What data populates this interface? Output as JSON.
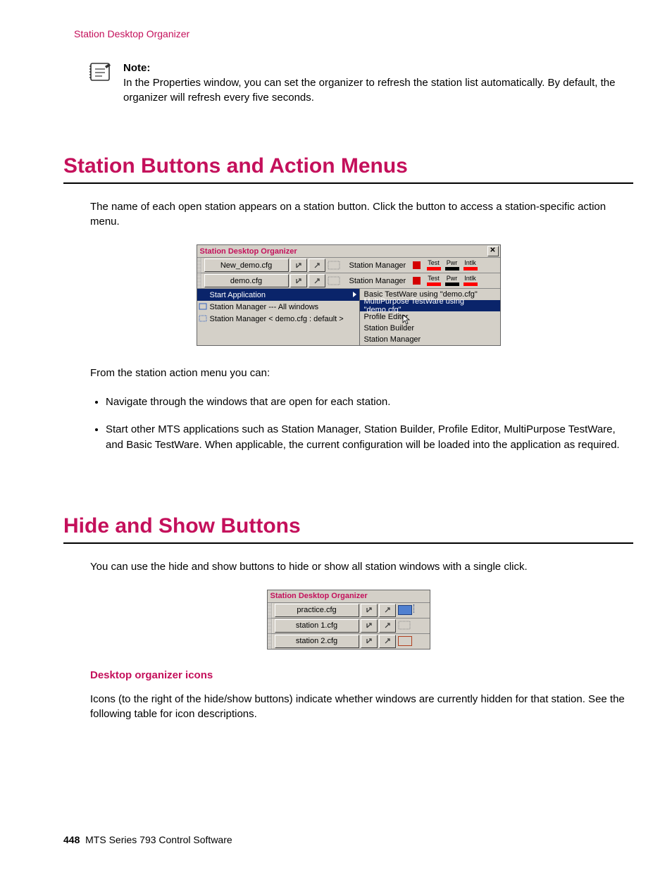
{
  "header": "Station Desktop Organizer",
  "note": {
    "label": "Note:",
    "body": "In the Properties window, you can set the organizer to refresh the station list automatically. By default, the organizer will refresh every five seconds."
  },
  "section1": {
    "heading": "Station Buttons and Action Menus",
    "intro": "The name of each open station appears on a station button. Click the button to access a station-specific action menu.",
    "lead": "From the station action menu you can:",
    "bullets": [
      "Navigate through the windows that are open for each station.",
      "Start other MTS applications such as Station Manager, Station Builder, Profile Editor, MultiPurpose TestWare, and Basic TestWare. When applicable, the current configuration will be loaded into the application as required."
    ]
  },
  "section2": {
    "heading": "Hide and Show Buttons",
    "intro": "You can use the hide and show buttons to hide or show all station windows with a single click.",
    "sub": "Desktop organizer icons",
    "body": "Icons (to the right of the hide/show buttons) indicate whether windows are currently hidden for that station. See the following table for icon descriptions."
  },
  "screenshot1": {
    "title": "Station Desktop Organizer",
    "rows": [
      {
        "station": "New_demo.cfg",
        "status": "Station Manager",
        "ind": [
          "Test",
          "Pwr",
          "Intlk"
        ]
      },
      {
        "station": "demo.cfg",
        "status": "Station Manager",
        "ind": [
          "Test",
          "Pwr",
          "Intlk"
        ]
      }
    ],
    "left_menu": [
      "Start Application",
      "Station Manager --- All windows",
      "Station Manager < demo.cfg : default >"
    ],
    "right_menu": [
      "Basic TestWare using \"demo.cfg\"",
      "MultiPurpose TestWare using \"demo.cfg\"",
      "Profile Editor",
      "Station Builder",
      "Station Manager"
    ]
  },
  "screenshot2": {
    "title": "Station Desktop Organizer",
    "rows": [
      {
        "station": "practice.cfg"
      },
      {
        "station": "station 1.cfg"
      },
      {
        "station": "station 2.cfg"
      }
    ]
  },
  "footer": {
    "page": "448",
    "title": "MTS Series 793 Control Software"
  }
}
